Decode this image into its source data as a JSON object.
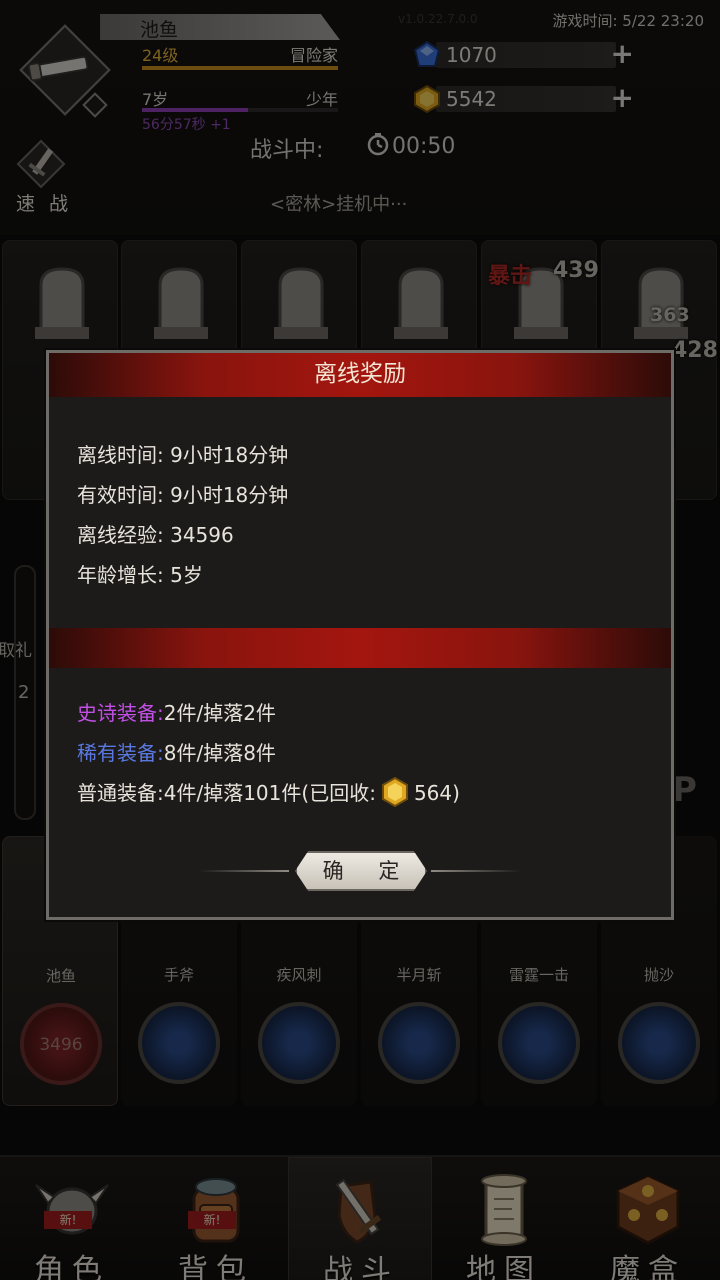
{
  "player": {
    "name": "池鱼",
    "level": "24级",
    "class": "冒险家",
    "age": "7岁",
    "age_stage": "少年",
    "age_timer": "56分57秒 +1",
    "level_progress": 1.0,
    "age_progress": 0.54
  },
  "header": {
    "version": "v1.0.22.7.0.0",
    "game_time": "游戏时间: 5/22 23:20",
    "gems": "1070",
    "gold": "5542",
    "quick_battle": "速 战",
    "battle_status": "战斗中:",
    "battle_timer": "00:50",
    "idle_status": "<密林>挂机中···"
  },
  "enemies": {
    "damage": [
      {
        "label": "暴击",
        "value": "439"
      },
      {
        "value": "363"
      },
      {
        "value": "428"
      }
    ]
  },
  "side": {
    "text": "取礼",
    "num": "2",
    "p": "P"
  },
  "skills": [
    {
      "label": "池鱼",
      "hp": "3496"
    },
    {
      "label": "手斧"
    },
    {
      "label": "疾风刺"
    },
    {
      "label": "半月斩"
    },
    {
      "label": "雷霆一击"
    },
    {
      "label": "抛沙"
    }
  ],
  "nav": [
    {
      "label": "角色",
      "badge": "新!"
    },
    {
      "label": "背包",
      "badge": "新!"
    },
    {
      "label": "战斗"
    },
    {
      "label": "地图"
    },
    {
      "label": "魔盒"
    }
  ],
  "dialog": {
    "title": "离线奖励",
    "offline_time_label": "离线时间:",
    "offline_time": "9小时18分钟",
    "effective_time_label": "有效时间:",
    "effective_time": "9小时18分钟",
    "exp_label": "离线经验:",
    "exp": "34596",
    "age_label": "年龄增长:",
    "age": "5岁",
    "epic_label": "史诗装备:",
    "epic": "2件/掉落2件",
    "rare_label": "稀有装备:",
    "rare": "8件/掉落8件",
    "normal_label": "普通装备:",
    "normal": "4件/掉落101件(已回收:",
    "normal_recycled": "564)",
    "confirm": "确 定"
  },
  "colors": {
    "epic": "#c24fe6",
    "rare": "#5a78e0",
    "gold_text": "#e3b33a",
    "title_red": "#a3160f"
  }
}
